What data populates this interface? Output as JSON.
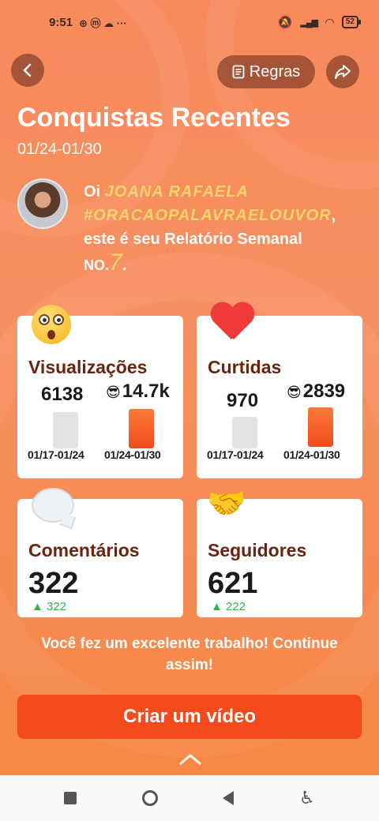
{
  "status_bar": {
    "time": "9:51",
    "left_icons": "⊕ ⓜ ☁ ···",
    "battery": "52"
  },
  "nav": {
    "back_icon": "back-icon",
    "rules_label": "Regras",
    "share_icon": "share-icon"
  },
  "header": {
    "title": "Conquistas Recentes",
    "date_range": "01/24-01/30"
  },
  "greeting": {
    "prefix": "Oi ",
    "name": "JOANA RAFAELA",
    "hashtag": "#ORACAOPALAVRAELOUVOR",
    "comma": ",",
    "line3": "este é seu Relatório Semanal",
    "no_label": "NO.",
    "number": "7",
    "dot": "."
  },
  "cards": {
    "views": {
      "title": "Visualizações",
      "prev_value": "6138",
      "curr_value": "14.7k",
      "prev_range": "01/17-01/24",
      "curr_range": "01/24-01/30"
    },
    "likes": {
      "title": "Curtidas",
      "prev_value": "970",
      "curr_value": "2839",
      "prev_range": "01/17-01/24",
      "curr_range": "01/24-01/30"
    },
    "comments": {
      "title": "Comentários",
      "value": "322",
      "delta": "▲ 322"
    },
    "followers": {
      "title": "Seguidores",
      "value": "621",
      "delta": "▲ 222"
    }
  },
  "message": "Você fez um excelente trabalho! Continue assim!",
  "cta_label": "Criar um vídeo",
  "colors": {
    "accent": "#f44b1d",
    "title_brown": "#6b2410",
    "highlight": "#ffd66b",
    "delta_green": "#2eb84a"
  }
}
